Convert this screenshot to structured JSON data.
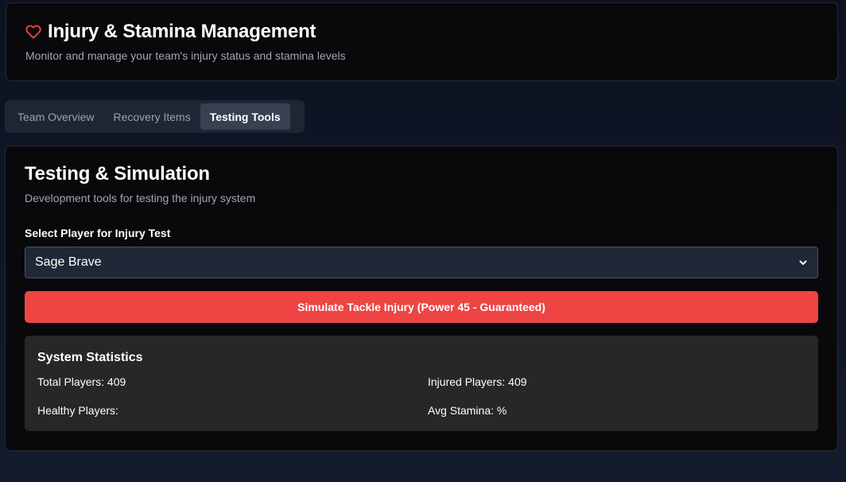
{
  "header": {
    "title": "Injury & Stamina Management",
    "subtitle": "Monitor and manage your team's injury status and stamina levels",
    "icon": "heart-icon",
    "icon_color": "#ef4444"
  },
  "tabs": [
    {
      "label": "Team Overview",
      "active": false
    },
    {
      "label": "Recovery Items",
      "active": false
    },
    {
      "label": "Testing Tools",
      "active": true
    }
  ],
  "testing": {
    "title": "Testing & Simulation",
    "subtitle": "Development tools for testing the injury system",
    "select_label": "Select Player for Injury Test",
    "selected_player": "Sage Brave",
    "simulate_button": "Simulate Tackle Injury (Power 45 - Guaranteed)",
    "button_color": "#ef4444"
  },
  "stats": {
    "title": "System Statistics",
    "total_players": "Total Players: 409",
    "injured_players": "Injured Players: 409",
    "healthy_players": "Healthy Players:",
    "avg_stamina": "Avg Stamina: %"
  }
}
